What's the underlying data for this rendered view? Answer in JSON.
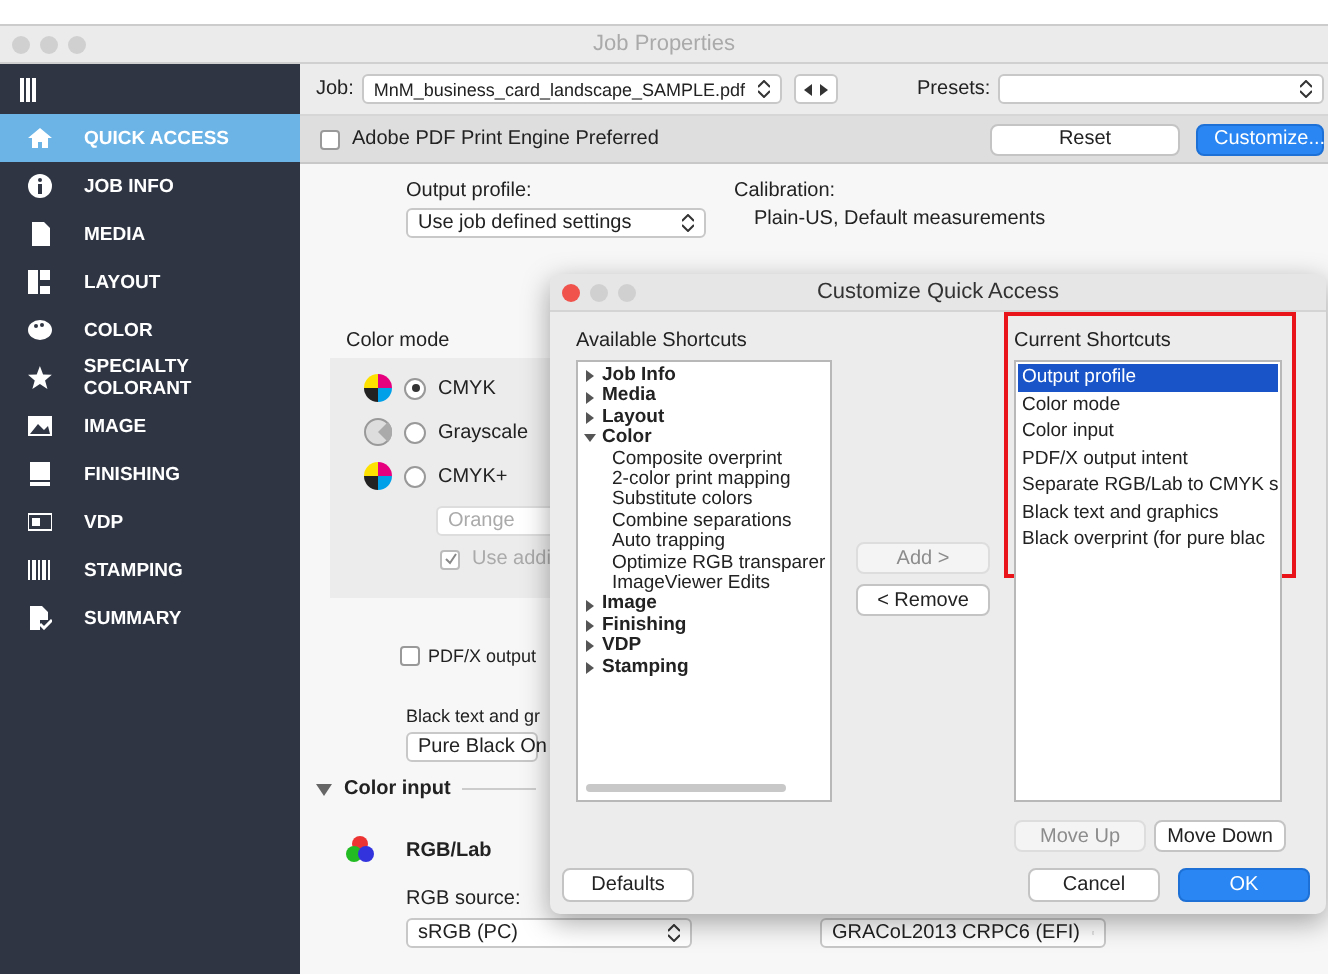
{
  "window": {
    "title": "Job Properties"
  },
  "sidebar": {
    "items": [
      {
        "label": "QUICK ACCESS",
        "selected": true
      },
      {
        "label": "JOB INFO",
        "selected": false
      },
      {
        "label": "MEDIA",
        "selected": false
      },
      {
        "label": "LAYOUT",
        "selected": false
      },
      {
        "label": "COLOR",
        "selected": false
      },
      {
        "label": "SPECIALTY COLORANT",
        "selected": false
      },
      {
        "label": "IMAGE",
        "selected": false
      },
      {
        "label": "FINISHING",
        "selected": false
      },
      {
        "label": "VDP",
        "selected": false
      },
      {
        "label": "STAMPING",
        "selected": false
      },
      {
        "label": "SUMMARY",
        "selected": false
      }
    ]
  },
  "job_bar": {
    "job_label": "Job:",
    "job_value": "MnM_business_card_landscape_SAMPLE.pdf",
    "presets_label": "Presets:"
  },
  "toolbar": {
    "checkbox": {
      "label": "Adobe PDF Print Engine Preferred",
      "checked": false
    },
    "buttons": [
      {
        "label": "Reset",
        "primary": false
      },
      {
        "label": "Customize...",
        "primary": true
      }
    ]
  },
  "output_profile": {
    "label": "Output profile:",
    "value": "Use job defined settings",
    "calibration_label": "Calibration:",
    "calibration_value": "Plain-US, Default measurements"
  },
  "color_mode": {
    "label": "Color mode",
    "options": [
      {
        "label": "CMYK",
        "selected": true
      },
      {
        "label": "Grayscale",
        "selected": false
      },
      {
        "label": "CMYK+",
        "selected": false
      }
    ],
    "colorant_select": "Orange",
    "additional": {
      "label": "Use addi",
      "checked": true
    }
  },
  "pdfx": {
    "label": "PDF/X output",
    "checked": false
  },
  "black_text": {
    "label": "Black text and gr",
    "value": "Pure Black On"
  },
  "color_input": {
    "title": "Color input",
    "expanded": true,
    "source_kind": "RGB/Lab",
    "source_label": "RGB source:",
    "source_value": "sRGB (PC)",
    "target_value": "GRACoL2013 CRPC6 (EFI)"
  },
  "dialog": {
    "title": "Customize Quick Access",
    "available_label": "Available Shortcuts",
    "available": [
      {
        "label": "Job Info",
        "expanded": false
      },
      {
        "label": "Media",
        "expanded": false
      },
      {
        "label": "Layout",
        "expanded": false
      },
      {
        "label": "Color",
        "expanded": true,
        "children": [
          {
            "label": "Composite overprint"
          },
          {
            "label": "2-color print mapping"
          },
          {
            "label": "Substitute colors"
          },
          {
            "label": "Combine separations"
          },
          {
            "label": "Auto trapping"
          },
          {
            "label": "Optimize RGB transparer"
          },
          {
            "label": "ImageViewer Edits"
          }
        ]
      },
      {
        "label": "Image",
        "expanded": false
      },
      {
        "label": "Finishing",
        "expanded": false
      },
      {
        "label": "VDP",
        "expanded": false
      },
      {
        "label": "Stamping",
        "expanded": false
      }
    ],
    "add_button": {
      "label": "Add >",
      "disabled": true
    },
    "remove_button": {
      "label": "< Remove",
      "disabled": false
    },
    "current_label": "Current Shortcuts",
    "current": [
      {
        "label": "Output profile",
        "selected": true
      },
      {
        "label": "Color mode",
        "selected": false
      },
      {
        "label": "Color input",
        "selected": false
      },
      {
        "label": "PDF/X output intent",
        "selected": false
      },
      {
        "label": "Separate RGB/Lab to CMYK s",
        "selected": false
      },
      {
        "label": "Black text and graphics",
        "selected": false
      },
      {
        "label": "Black overprint (for pure blac",
        "selected": false
      }
    ],
    "move_up": {
      "label": "Move Up",
      "disabled": true
    },
    "move_down": {
      "label": "Move Down",
      "disabled": false
    },
    "defaults": "Defaults",
    "cancel": "Cancel",
    "ok": "OK"
  }
}
